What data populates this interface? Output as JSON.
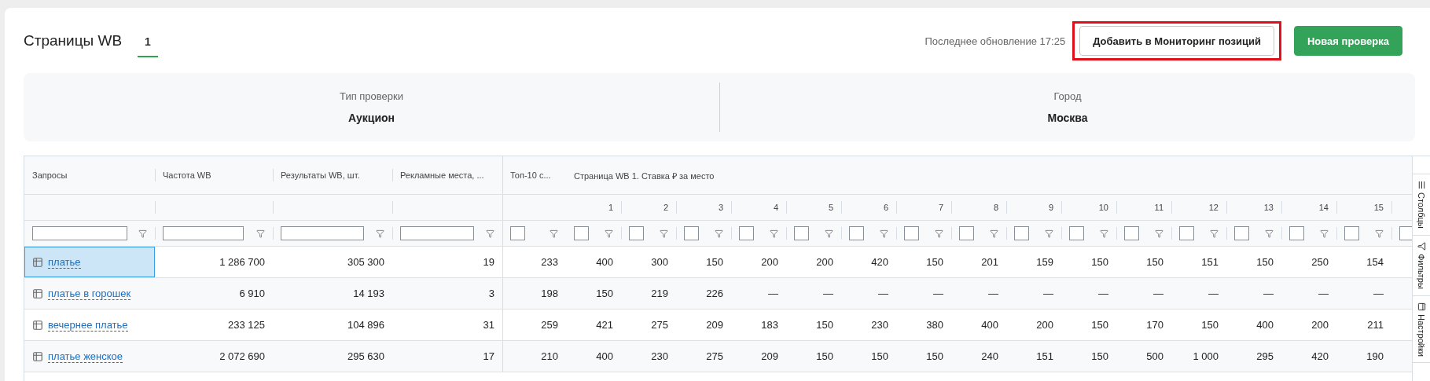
{
  "header": {
    "title": "Страницы WB",
    "tabs": [
      {
        "label": "1",
        "selected": true
      }
    ],
    "last_update": "Последнее обновление 17:25",
    "buttons": [
      {
        "label": "Добавить в Мониторинг позиций",
        "kind": "secondary",
        "highlighted": true
      },
      {
        "label": "Новая проверка",
        "kind": "primary",
        "highlighted": false
      }
    ]
  },
  "summary": [
    {
      "label": "Тип проверки",
      "value": "Аукцион"
    },
    {
      "label": "Город",
      "value": "Москва"
    }
  ],
  "table": {
    "columns": [
      {
        "label": "Запросы",
        "kind": "text"
      },
      {
        "label": "Частота WB",
        "kind": "text"
      },
      {
        "label": "Результаты WB, шт.",
        "kind": "text"
      },
      {
        "label": "Рекламные места, ...",
        "kind": "text"
      },
      {
        "label": "Топ-10 с...",
        "kind": "box"
      }
    ],
    "group_header": "Страница WB 1. Ставка ₽ за место",
    "bid_columns": [
      "1",
      "2",
      "3",
      "4",
      "5",
      "6",
      "7",
      "8",
      "9",
      "10",
      "11",
      "12",
      "13",
      "14",
      "15"
    ],
    "rows": [
      {
        "query": "платье",
        "selected": true,
        "cells": [
          "1 286 700",
          "305 300",
          "19",
          "233"
        ],
        "bids": [
          "400",
          "300",
          "150",
          "200",
          "200",
          "420",
          "150",
          "201",
          "159",
          "150",
          "150",
          "151",
          "150",
          "250",
          "154"
        ]
      },
      {
        "query": "платье в горошек",
        "selected": false,
        "cells": [
          "6 910",
          "14 193",
          "3",
          "198"
        ],
        "bids": [
          "150",
          "219",
          "226",
          "—",
          "—",
          "—",
          "—",
          "—",
          "—",
          "—",
          "—",
          "—",
          "—",
          "—",
          "—"
        ]
      },
      {
        "query": "вечернее платье",
        "selected": false,
        "cells": [
          "233 125",
          "104 896",
          "31",
          "259"
        ],
        "bids": [
          "421",
          "275",
          "209",
          "183",
          "150",
          "230",
          "380",
          "400",
          "200",
          "150",
          "170",
          "150",
          "400",
          "200",
          "211"
        ]
      },
      {
        "query": "платье женское",
        "selected": false,
        "cells": [
          "2 072 690",
          "295 630",
          "17",
          "210"
        ],
        "bids": [
          "400",
          "230",
          "275",
          "209",
          "150",
          "150",
          "150",
          "240",
          "151",
          "150",
          "500",
          "1 000",
          "295",
          "420",
          "190"
        ]
      }
    ]
  },
  "side_panel": [
    {
      "label": "Столбцы",
      "kind": "columns"
    },
    {
      "label": "Фильтры",
      "kind": "filters"
    },
    {
      "label": "Настройки",
      "kind": "settings"
    }
  ]
}
